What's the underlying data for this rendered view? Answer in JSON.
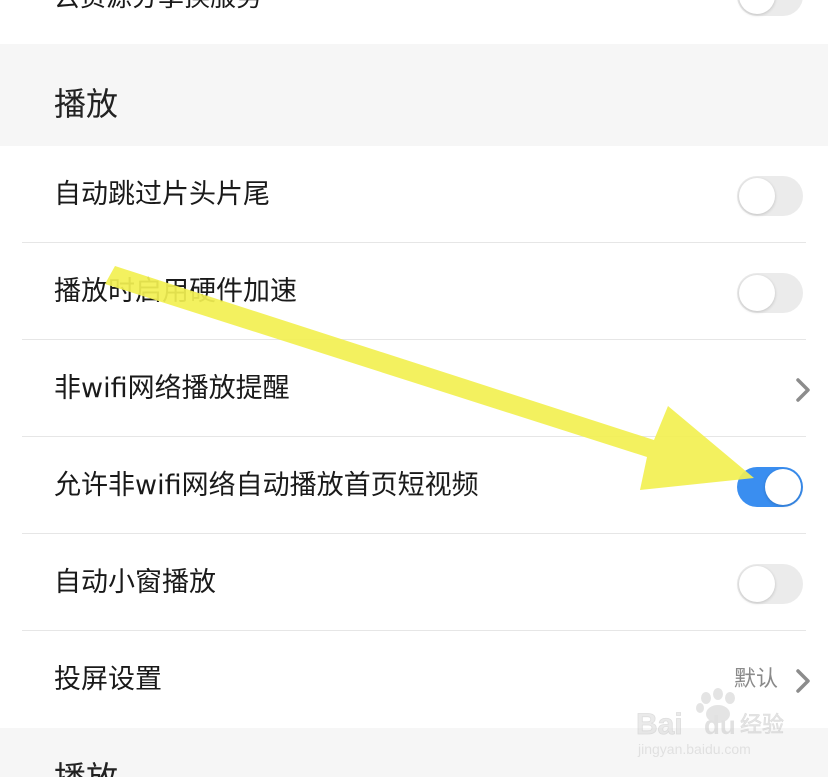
{
  "top_section": {
    "partial_row_label": "云资源分享换服务",
    "partial_row_toggle_on": false
  },
  "play_section": {
    "header": "播放",
    "rows": [
      {
        "label": "自动跳过片头片尾",
        "control": "toggle",
        "on": false
      },
      {
        "label": "播放时启用硬件加速",
        "control": "toggle",
        "on": false
      },
      {
        "label": "非wifi网络播放提醒",
        "control": "chevron"
      },
      {
        "label": "允许非wifi网络自动播放首页短视频",
        "control": "toggle",
        "on": true
      },
      {
        "label": "自动小窗播放",
        "control": "toggle",
        "on": false
      },
      {
        "label": "投屏设置",
        "control": "chevron",
        "value": "默认"
      }
    ]
  },
  "next_section": {
    "header_partial": "播放"
  },
  "watermark": {
    "brand": "Baidu经验",
    "url": "jingyan.baidu.com"
  },
  "colors": {
    "toggle_on": "#3a8ef0",
    "toggle_off": "#ebebeb",
    "annotation_arrow": "#f2f051"
  },
  "icons": {
    "chevron": "chevron-right-icon",
    "annotation": "arrow-annotation-icon"
  }
}
